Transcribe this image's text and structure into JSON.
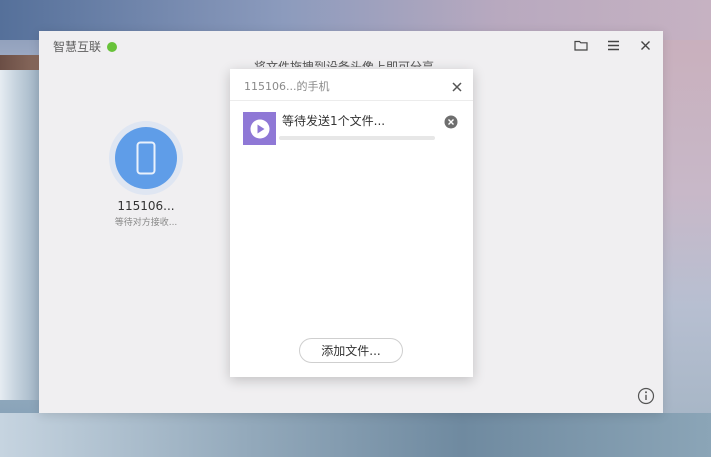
{
  "app": {
    "title": "智慧互联",
    "hint": "将文件拖拽到设备头像上即可分享",
    "status_color": "#68c23a"
  },
  "device": {
    "name": "115106...",
    "status": "等待对方接收...",
    "icon": "phone-icon"
  },
  "dialog": {
    "title": "115106...的手机",
    "file": {
      "label": "等待发送1个文件...",
      "progress": 0,
      "icon": "video-play-icon"
    },
    "add_button": "添加文件..."
  },
  "icons": {
    "folder": "folder-icon",
    "menu": "menu-icon",
    "close": "close-icon",
    "info": "info-icon"
  },
  "colors": {
    "accent": "#5f9de8",
    "file_thumb": "#8f78d6"
  }
}
